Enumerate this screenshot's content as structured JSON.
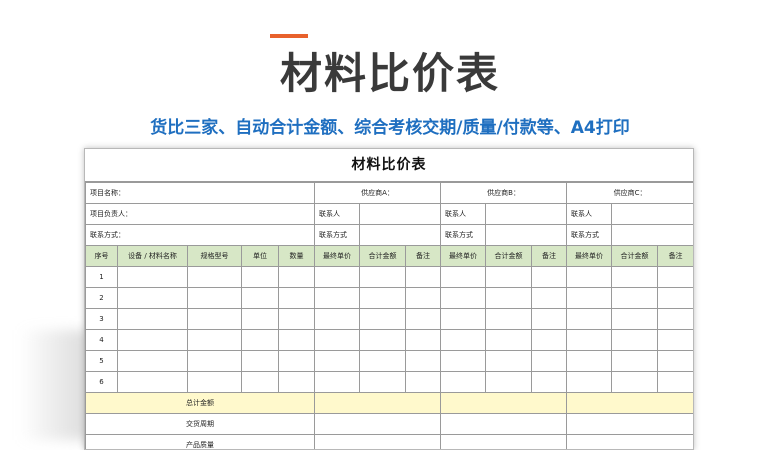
{
  "page": {
    "hero_title": "材料比价表",
    "subtitle": "货比三家、自动合计金额、综合考核交期/质量/付款等、A4打印"
  },
  "sheet": {
    "title": "材料比价表",
    "info": {
      "project_name": "项目名称：",
      "project_manager": "项目负责人：",
      "contact_method": "联系方式：",
      "suppliers": [
        "供应商A：",
        "供应商B：",
        "供应商C："
      ],
      "contact_person": "联系人",
      "contact_method_short": "联系方式"
    },
    "headers": {
      "seq": "序号",
      "name": "设备 / 材料名称",
      "spec": "规格型号",
      "unit": "单位",
      "qty": "数量",
      "final_price": "最终单价",
      "total": "合计金额",
      "note": "备注"
    },
    "rows": [
      "1",
      "2",
      "3",
      "4",
      "5",
      "6"
    ],
    "summary": {
      "total_amount": "总计金额",
      "lead_time": "交货周期",
      "quality": "产品质量"
    }
  },
  "colors": {
    "accent": "#e8612c",
    "subtitle": "#1f6fc0",
    "header_bg": "#d7e7c6",
    "summary_bg": "#fff9cc"
  }
}
